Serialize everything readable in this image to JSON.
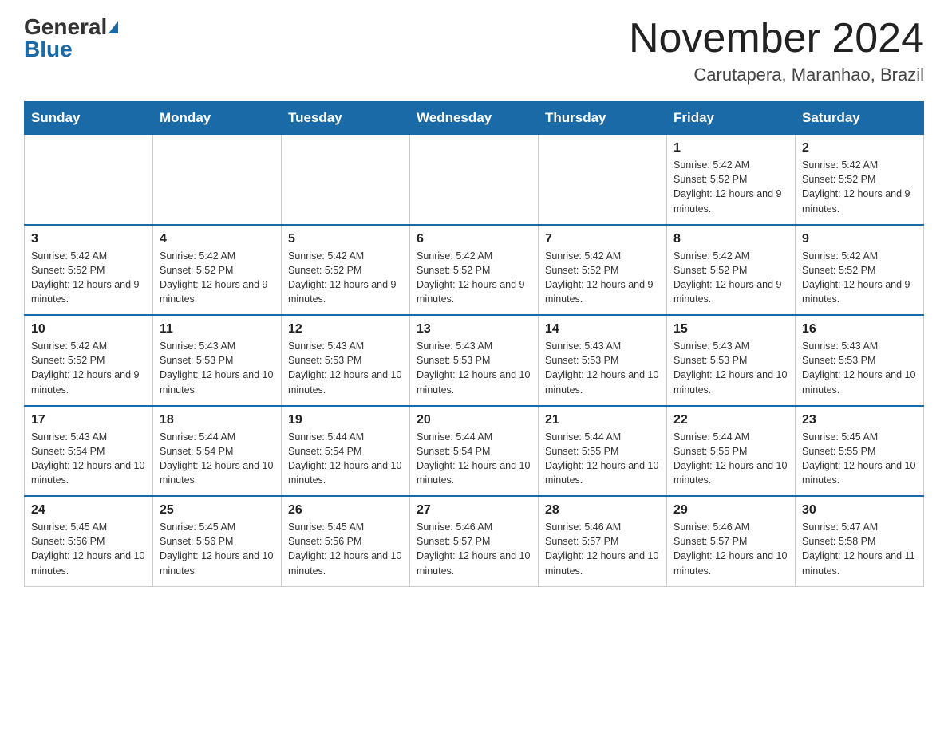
{
  "header": {
    "logo_general": "General",
    "logo_blue": "Blue",
    "month_title": "November 2024",
    "location": "Carutapera, Maranhao, Brazil"
  },
  "days_of_week": [
    "Sunday",
    "Monday",
    "Tuesday",
    "Wednesday",
    "Thursday",
    "Friday",
    "Saturday"
  ],
  "weeks": [
    [
      {
        "day": "",
        "info": ""
      },
      {
        "day": "",
        "info": ""
      },
      {
        "day": "",
        "info": ""
      },
      {
        "day": "",
        "info": ""
      },
      {
        "day": "",
        "info": ""
      },
      {
        "day": "1",
        "info": "Sunrise: 5:42 AM\nSunset: 5:52 PM\nDaylight: 12 hours and 9 minutes."
      },
      {
        "day": "2",
        "info": "Sunrise: 5:42 AM\nSunset: 5:52 PM\nDaylight: 12 hours and 9 minutes."
      }
    ],
    [
      {
        "day": "3",
        "info": "Sunrise: 5:42 AM\nSunset: 5:52 PM\nDaylight: 12 hours and 9 minutes."
      },
      {
        "day": "4",
        "info": "Sunrise: 5:42 AM\nSunset: 5:52 PM\nDaylight: 12 hours and 9 minutes."
      },
      {
        "day": "5",
        "info": "Sunrise: 5:42 AM\nSunset: 5:52 PM\nDaylight: 12 hours and 9 minutes."
      },
      {
        "day": "6",
        "info": "Sunrise: 5:42 AM\nSunset: 5:52 PM\nDaylight: 12 hours and 9 minutes."
      },
      {
        "day": "7",
        "info": "Sunrise: 5:42 AM\nSunset: 5:52 PM\nDaylight: 12 hours and 9 minutes."
      },
      {
        "day": "8",
        "info": "Sunrise: 5:42 AM\nSunset: 5:52 PM\nDaylight: 12 hours and 9 minutes."
      },
      {
        "day": "9",
        "info": "Sunrise: 5:42 AM\nSunset: 5:52 PM\nDaylight: 12 hours and 9 minutes."
      }
    ],
    [
      {
        "day": "10",
        "info": "Sunrise: 5:42 AM\nSunset: 5:52 PM\nDaylight: 12 hours and 9 minutes."
      },
      {
        "day": "11",
        "info": "Sunrise: 5:43 AM\nSunset: 5:53 PM\nDaylight: 12 hours and 10 minutes."
      },
      {
        "day": "12",
        "info": "Sunrise: 5:43 AM\nSunset: 5:53 PM\nDaylight: 12 hours and 10 minutes."
      },
      {
        "day": "13",
        "info": "Sunrise: 5:43 AM\nSunset: 5:53 PM\nDaylight: 12 hours and 10 minutes."
      },
      {
        "day": "14",
        "info": "Sunrise: 5:43 AM\nSunset: 5:53 PM\nDaylight: 12 hours and 10 minutes."
      },
      {
        "day": "15",
        "info": "Sunrise: 5:43 AM\nSunset: 5:53 PM\nDaylight: 12 hours and 10 minutes."
      },
      {
        "day": "16",
        "info": "Sunrise: 5:43 AM\nSunset: 5:53 PM\nDaylight: 12 hours and 10 minutes."
      }
    ],
    [
      {
        "day": "17",
        "info": "Sunrise: 5:43 AM\nSunset: 5:54 PM\nDaylight: 12 hours and 10 minutes."
      },
      {
        "day": "18",
        "info": "Sunrise: 5:44 AM\nSunset: 5:54 PM\nDaylight: 12 hours and 10 minutes."
      },
      {
        "day": "19",
        "info": "Sunrise: 5:44 AM\nSunset: 5:54 PM\nDaylight: 12 hours and 10 minutes."
      },
      {
        "day": "20",
        "info": "Sunrise: 5:44 AM\nSunset: 5:54 PM\nDaylight: 12 hours and 10 minutes."
      },
      {
        "day": "21",
        "info": "Sunrise: 5:44 AM\nSunset: 5:55 PM\nDaylight: 12 hours and 10 minutes."
      },
      {
        "day": "22",
        "info": "Sunrise: 5:44 AM\nSunset: 5:55 PM\nDaylight: 12 hours and 10 minutes."
      },
      {
        "day": "23",
        "info": "Sunrise: 5:45 AM\nSunset: 5:55 PM\nDaylight: 12 hours and 10 minutes."
      }
    ],
    [
      {
        "day": "24",
        "info": "Sunrise: 5:45 AM\nSunset: 5:56 PM\nDaylight: 12 hours and 10 minutes."
      },
      {
        "day": "25",
        "info": "Sunrise: 5:45 AM\nSunset: 5:56 PM\nDaylight: 12 hours and 10 minutes."
      },
      {
        "day": "26",
        "info": "Sunrise: 5:45 AM\nSunset: 5:56 PM\nDaylight: 12 hours and 10 minutes."
      },
      {
        "day": "27",
        "info": "Sunrise: 5:46 AM\nSunset: 5:57 PM\nDaylight: 12 hours and 10 minutes."
      },
      {
        "day": "28",
        "info": "Sunrise: 5:46 AM\nSunset: 5:57 PM\nDaylight: 12 hours and 10 minutes."
      },
      {
        "day": "29",
        "info": "Sunrise: 5:46 AM\nSunset: 5:57 PM\nDaylight: 12 hours and 10 minutes."
      },
      {
        "day": "30",
        "info": "Sunrise: 5:47 AM\nSunset: 5:58 PM\nDaylight: 12 hours and 11 minutes."
      }
    ]
  ]
}
